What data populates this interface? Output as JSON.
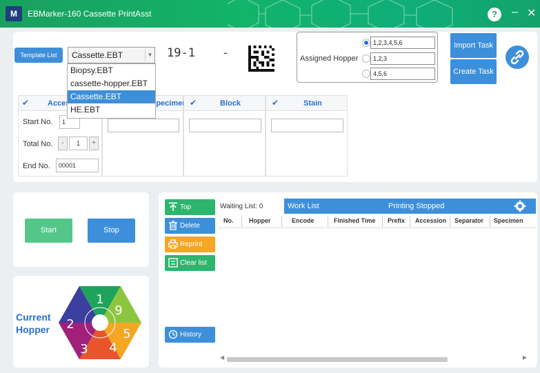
{
  "window": {
    "title": "EBMarker-160 Cassette PrintAsst",
    "logo_text": "M",
    "help": "?",
    "minimize": "–",
    "close": "✕"
  },
  "template": {
    "list_button": "Template List",
    "selected": "Cassette.EBT",
    "options": [
      "Biopsy.EBT",
      "cassette-hopper.EBT",
      "Cassette.EBT",
      "HE.EBT"
    ]
  },
  "preview": {
    "number": "19-1",
    "dash": "-"
  },
  "assigned_hopper": {
    "label": "Assigned Hopper",
    "options": [
      {
        "value": "1,2,3,4,5,6",
        "selected": true
      },
      {
        "value": "1,2,3",
        "selected": false
      },
      {
        "value": "4,5,6",
        "selected": false
      }
    ]
  },
  "actions": {
    "import_task": "Import Task",
    "create_task": "Create Task",
    "link_icon": "link-icon"
  },
  "columns": {
    "accession": "Accession",
    "specimen": "Specimen",
    "block": "Block",
    "stain": "Stain"
  },
  "fields": {
    "start_label": "Start No.",
    "start_value": "1",
    "total_label": "Total No.",
    "total_value": "1",
    "minus": "-",
    "plus": "+",
    "end_label": "End No.",
    "end_value": "00001"
  },
  "controls": {
    "start": "Start",
    "stop": "Stop"
  },
  "current_hopper": {
    "label": "Current Hopper",
    "segments": [
      "1",
      "9",
      "5",
      "4",
      "3",
      "2"
    ]
  },
  "side_buttons": {
    "top": "Top",
    "delete": "Delete",
    "reprint": "Reprint",
    "clear": "Clear list",
    "history": "History"
  },
  "work_list": {
    "waiting_label": "Waiting List:",
    "waiting_count": "0",
    "title": "Work List",
    "status": "Printing Stopped",
    "columns": [
      "No.",
      "Hopper",
      "Encode",
      "Finished Time",
      "Prefix",
      "Accession",
      "Separator",
      "Specimen"
    ]
  },
  "colors": {
    "accent": "#3d8fd9",
    "title_green": "#1aa05e",
    "start_green": "#55c68a",
    "reprint_orange": "#f5a623"
  }
}
